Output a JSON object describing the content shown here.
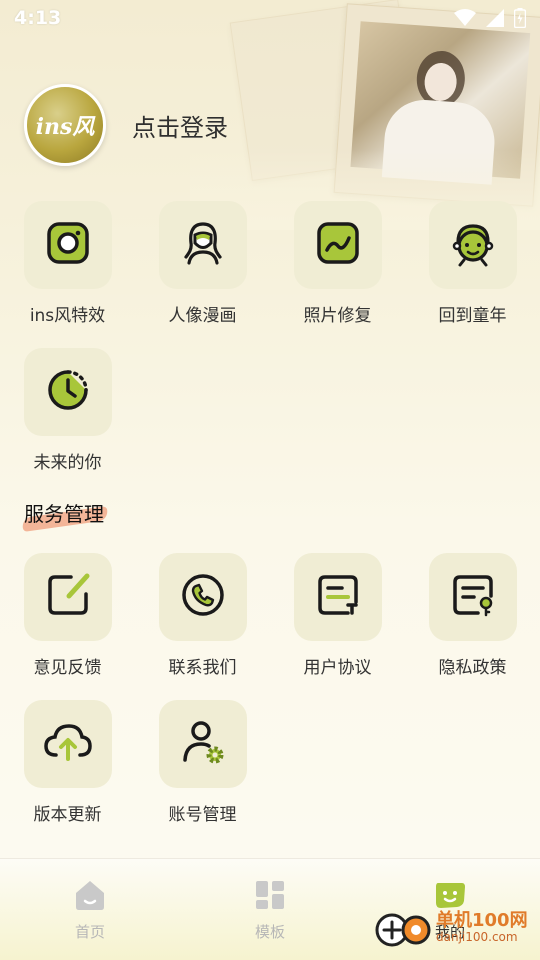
{
  "status_bar": {
    "time": "4:13"
  },
  "profile": {
    "avatar_text": "ins风",
    "login_label": "点击登录"
  },
  "features": [
    {
      "label": "ins风特效",
      "icon": "instagram-icon"
    },
    {
      "label": "人像漫画",
      "icon": "portrait-icon"
    },
    {
      "label": "照片修复",
      "icon": "photo-repair-icon"
    },
    {
      "label": "回到童年",
      "icon": "child-face-icon"
    },
    {
      "label": "未来的你",
      "icon": "future-clock-icon"
    }
  ],
  "services": {
    "title": "服务管理",
    "items": [
      {
        "label": "意见反馈",
        "icon": "feedback-icon"
      },
      {
        "label": "联系我们",
        "icon": "phone-icon"
      },
      {
        "label": "用户协议",
        "icon": "agreement-icon"
      },
      {
        "label": "隐私政策",
        "icon": "privacy-icon"
      },
      {
        "label": "版本更新",
        "icon": "cloud-upload-icon"
      },
      {
        "label": "账号管理",
        "icon": "account-settings-icon"
      }
    ]
  },
  "bottom_nav": {
    "items": [
      {
        "label": "首页",
        "icon": "home-icon",
        "active": false
      },
      {
        "label": "模板",
        "icon": "template-icon",
        "active": false
      },
      {
        "label": "我的",
        "icon": "mine-icon",
        "active": true
      }
    ]
  },
  "watermark": {
    "brand": "单机100网",
    "url": "danji100.com"
  },
  "colors": {
    "accent": "#a8c63a",
    "tile_bg": "#f0edd4",
    "icon_stroke": "#1a1a1a",
    "inactive_nav": "#b7b7b7"
  }
}
